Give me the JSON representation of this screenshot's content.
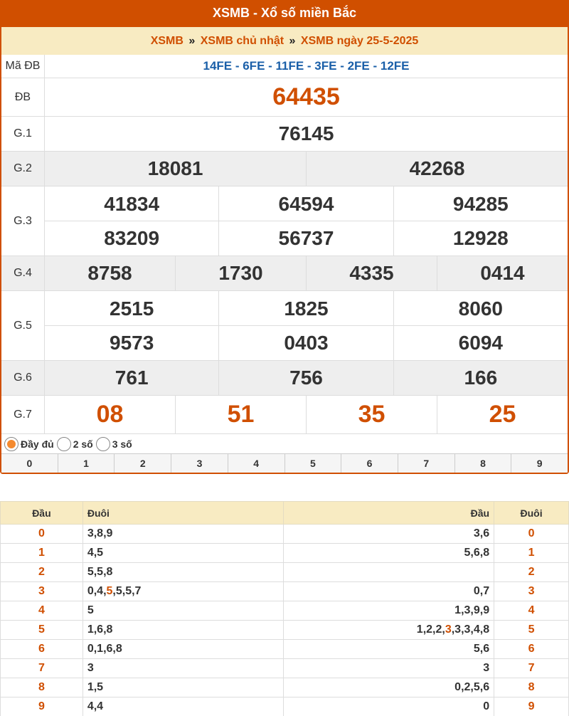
{
  "title": "XSMB - Xổ số miền Bắc",
  "breadcrumb": {
    "item1": "XSMB",
    "item2": "XSMB chủ nhật",
    "item3": "XSMB ngày 25-5-2025",
    "separator": "»"
  },
  "results": {
    "ma_db": {
      "label": "Mã ĐB",
      "value": "14FE - 6FE - 11FE - 3FE - 2FE - 12FE"
    },
    "db": {
      "label": "ĐB",
      "value": "64435"
    },
    "g1": {
      "label": "G.1",
      "values": [
        "76145"
      ]
    },
    "g2": {
      "label": "G.2",
      "values": [
        "18081",
        "42268"
      ]
    },
    "g3": {
      "label": "G.3",
      "values": [
        "41834",
        "64594",
        "94285",
        "83209",
        "56737",
        "12928"
      ]
    },
    "g4": {
      "label": "G.4",
      "values": [
        "8758",
        "1730",
        "4335",
        "0414"
      ]
    },
    "g5": {
      "label": "G.5",
      "values": [
        "2515",
        "1825",
        "8060",
        "9573",
        "0403",
        "6094"
      ]
    },
    "g6": {
      "label": "G.6",
      "values": [
        "761",
        "756",
        "166"
      ]
    },
    "g7": {
      "label": "G.7",
      "values": [
        "08",
        "51",
        "35",
        "25"
      ]
    }
  },
  "options": {
    "full": "Đầy đủ",
    "two": "2 số",
    "three": "3 số",
    "selected": "full"
  },
  "digits": [
    "0",
    "1",
    "2",
    "3",
    "4",
    "5",
    "6",
    "7",
    "8",
    "9"
  ],
  "loto": {
    "headers": {
      "dau": "Đầu",
      "duoi": "Đuôi",
      "dau2": "Đầu",
      "duoi2": "Đuôi"
    },
    "rows": [
      {
        "head": "0",
        "tails": "3,8,9",
        "heads": "3,6",
        "tail": "0"
      },
      {
        "head": "1",
        "tails": "4,5",
        "heads": "5,6,8",
        "tail": "1"
      },
      {
        "head": "2",
        "tails": "5,5,8",
        "heads": "",
        "tail": "2"
      },
      {
        "head": "3",
        "tails_pre": "0,4,",
        "tails_hl": "5",
        "tails_post": ",5,5,7",
        "heads": "0,7",
        "tail": "3"
      },
      {
        "head": "4",
        "tails": "5",
        "heads": "1,3,9,9",
        "tail": "4"
      },
      {
        "head": "5",
        "tails": "1,6,8",
        "heads_pre": "1,2,2,",
        "heads_hl": "3",
        "heads_post": ",3,3,4,8",
        "tail": "5"
      },
      {
        "head": "6",
        "tails": "0,1,6,8",
        "heads": "5,6",
        "tail": "6"
      },
      {
        "head": "7",
        "tails": "3",
        "heads": "3",
        "tail": "7"
      },
      {
        "head": "8",
        "tails": "1,5",
        "heads": "0,2,5,6",
        "tail": "8"
      },
      {
        "head": "9",
        "tails": "4,4",
        "heads": "0",
        "tail": "9"
      }
    ]
  }
}
